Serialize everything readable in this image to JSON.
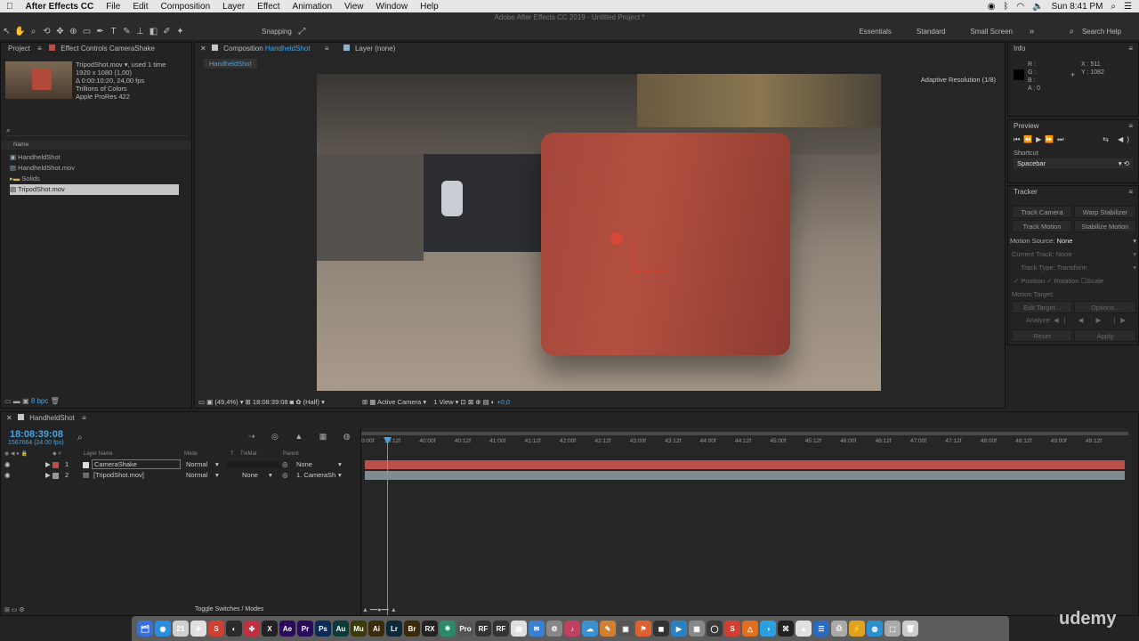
{
  "menubar": {
    "app": "After Effects CC",
    "items": [
      "File",
      "Edit",
      "Composition",
      "Layer",
      "Effect",
      "Animation",
      "View",
      "Window",
      "Help"
    ],
    "clock": "Sun 8:41 PM"
  },
  "window_title": "Adobe After Effects CC 2019 - Untitled Project *",
  "toolbar": {
    "snapping": "Snapping",
    "workspaces": [
      "Essentials",
      "Standard",
      "Small Screen"
    ],
    "search": "Search Help"
  },
  "project": {
    "tab": "Project",
    "effect_tab": "Effect Controls CameraShake",
    "asset": {
      "name": "TripodShot.mov ▾",
      "used": ", used 1 time",
      "lines": [
        "1920 x 1080 (1,00)",
        "Δ 0:00:10:20, 24,00 fps",
        "Trillions of Colors",
        "Apple ProRes 422"
      ]
    },
    "col_name": "Name",
    "items": [
      "HandheldShot",
      "HandheldShot.mov",
      "Solids",
      "TripodShot.mov"
    ],
    "bpc": "8 bpc"
  },
  "comp": {
    "tab_label": "Composition",
    "tab_name": "HandheldShot",
    "layer_tab": "Layer (none)",
    "crumb": "HandheldShot",
    "adaptive": "Adaptive Resolution (1/8)",
    "footer": {
      "zoom": "(49,4%)",
      "time": "18:08:39:08",
      "res": "(Half)",
      "camera": "Active Camera",
      "view": "1 View",
      "exposure": "+0,0"
    }
  },
  "info": {
    "title": "Info",
    "r": "R :",
    "g": "G :",
    "b": "B :",
    "a": "A : 0",
    "x": "X : 511",
    "y": "Y : 1082"
  },
  "preview": {
    "title": "Preview",
    "shortcut_label": "Shortcut",
    "shortcut": "Spacebar"
  },
  "tracker": {
    "title": "Tracker",
    "buttons": [
      "Track Camera",
      "Warp Stabilizer",
      "Track Motion",
      "Stabilize Motion"
    ],
    "motion_source_label": "Motion Source:",
    "motion_source": "None",
    "current_track_label": "Current Track:",
    "current_track": "None",
    "track_type_label": "Track Type:",
    "track_type": "Transform",
    "position": "Position",
    "rotation": "Rotation",
    "scale": "Scale",
    "motion_target": "Motion Target:",
    "edit_target": "Edit Target...",
    "options": "Options...",
    "analyze": "Analyze:",
    "reset": "Reset",
    "apply": "Apply"
  },
  "timeline": {
    "tab": "HandheldShot",
    "time": "18:08:39:08",
    "frames": "1567664 (24.00 fps)",
    "headers": {
      "layer_name": "Layer Name",
      "mode": "Mode",
      "t": "T",
      "trkmat": "TrkMat",
      "parent": "Parent"
    },
    "layers": [
      {
        "num": "1",
        "name": "CameraShake",
        "mode": "Normal",
        "trkmat": "",
        "parent": "None",
        "color": "#c24a45"
      },
      {
        "num": "2",
        "name": "[TripodShot.mov]",
        "mode": "Normal",
        "trkmat": "None",
        "parent": "1. CameraSh",
        "color": "#8a9aa0"
      }
    ],
    "ruler": [
      "0:00f",
      "39:12f",
      "40:00f",
      "40:12f",
      "41:00f",
      "41:12f",
      "42:00f",
      "42:12f",
      "43:00f",
      "43:12f",
      "44:00f",
      "44:12f",
      "45:00f",
      "45:12f",
      "46:00f",
      "46:12f",
      "47:00f",
      "47:12f",
      "48:00f",
      "48:12f",
      "49:00f",
      "49:12f"
    ],
    "toggle": "Toggle Switches / Modes"
  },
  "dock": [
    "🗂",
    "◉",
    "21",
    "✈",
    "S",
    "◐",
    "✤",
    "X",
    "Ae",
    "Pr",
    "Ps",
    "Au",
    "Mu",
    "Ai",
    "Lr",
    "Br",
    "RX",
    "⎈",
    "Pro",
    "RF",
    "RF",
    "▤",
    "✉",
    "⚙",
    "♪",
    "☁",
    "✎",
    "▣",
    "⚑",
    "◼",
    "▶",
    "▦",
    "◯",
    "S",
    "△",
    "◑",
    "⌘",
    "▲",
    "☰",
    "⎙",
    "⚡",
    "◍",
    "⬚",
    "🗑"
  ],
  "watermark": "udemy"
}
